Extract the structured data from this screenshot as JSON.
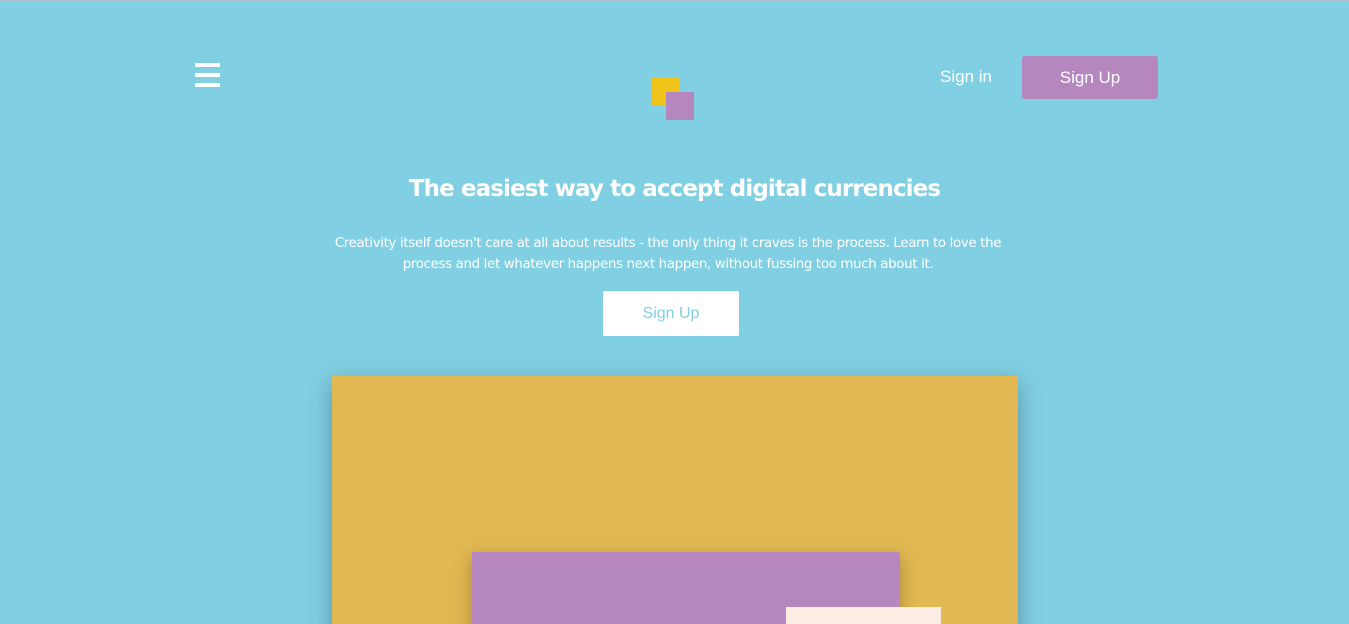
{
  "header": {
    "menu_icon": "hamburger-menu-icon",
    "logo_icon": "overlapping-squares-logo-icon",
    "signin_label": "Sign in",
    "signup_label": "Sign Up"
  },
  "hero": {
    "title": "The easiest way to accept digital currencies",
    "description": "Creativity itself doesn't care at all about results - the only thing it craves is the process. Learn to love the process and let whatever happens next happen, without fussing too much about it.",
    "cta_label": "Sign Up"
  },
  "colors": {
    "background": "#81cfe2",
    "accent_purple": "#b686bf",
    "accent_yellow": "#f0c419",
    "illustration_gold": "#e1b851",
    "illustration_cream": "#fdece3",
    "text": "#ffffff"
  }
}
